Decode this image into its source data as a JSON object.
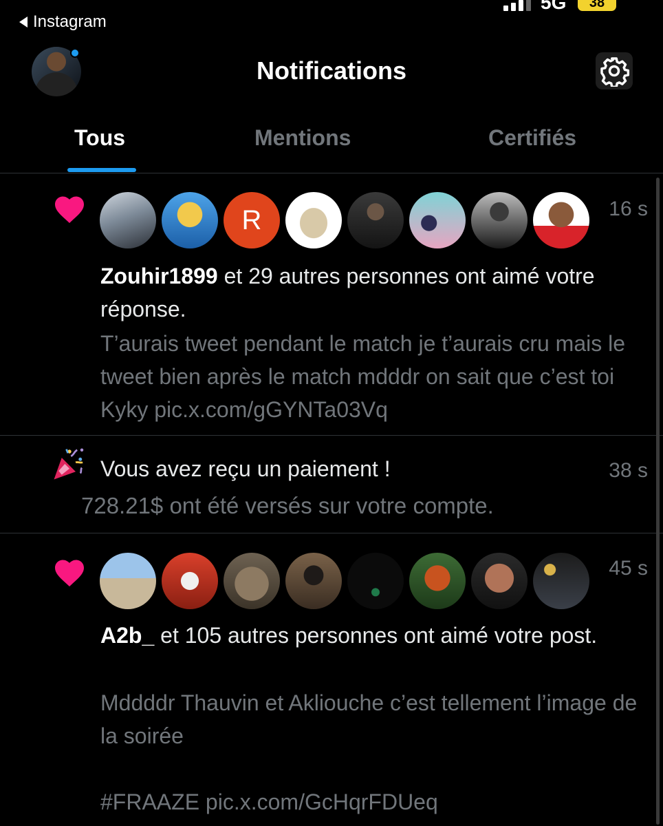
{
  "status_bar": {
    "back_app": "Instagram",
    "network": "5G",
    "battery": "38"
  },
  "header": {
    "title": "Notifications",
    "settings_icon": "gear-icon",
    "has_new_dot": true
  },
  "tabs": [
    {
      "label": "Tous",
      "active": true
    },
    {
      "label": "Mentions",
      "active": false
    },
    {
      "label": "Certifiés",
      "active": false
    }
  ],
  "notifications": [
    {
      "type": "like",
      "icon": "heart-icon",
      "time": "16 s",
      "avatar_letter": "R",
      "actor": "Zouhir1899",
      "action": " et 29 autres personnes ont aimé votre réponse.",
      "preview": "T’aurais tweet pendant le match je t’aurais cru mais le tweet bien après le match mdddr on sait que c’est toi Kyky pic.x.com/gGYNTa03Vq"
    },
    {
      "type": "payment",
      "icon": "party-popper-icon",
      "time": "38 s",
      "title": "Vous avez reçu un paiement !",
      "detail": "728.21$ ont été versés sur votre compte."
    },
    {
      "type": "like",
      "icon": "heart-icon",
      "time": "45 s",
      "actor": "A2b_",
      "action": " et 105 autres personnes ont aimé votre post.",
      "preview": "Mddddr Thauvin et Akliouche c’est tellement l’image de la soirée\n\n#FRAAZE pic.x.com/GcHqrFDUeq"
    }
  ],
  "colors": {
    "accent": "#1d9bf0",
    "heart": "#f91880",
    "muted": "#71767b",
    "background": "#000000"
  }
}
